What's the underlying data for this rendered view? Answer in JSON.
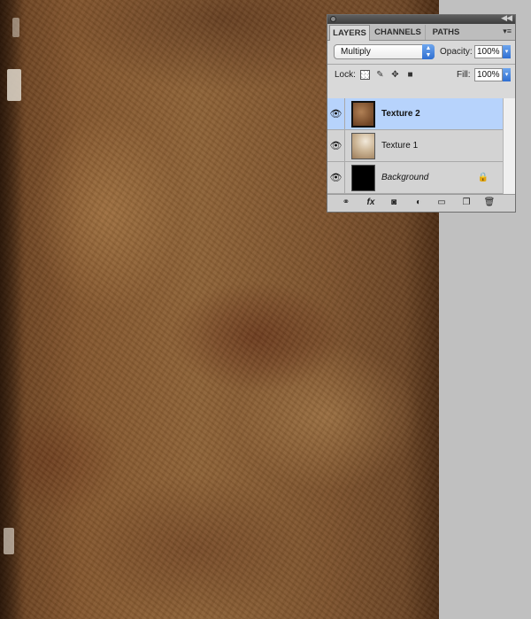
{
  "canvas": {
    "description_colors": {
      "accent": "#8e6236",
      "dark": "#3d230f"
    }
  },
  "panel": {
    "collapse_icon": "double-chevron-right",
    "tabs": [
      {
        "label": "LAYERS",
        "active": true
      },
      {
        "label": "CHANNELS",
        "active": false
      },
      {
        "label": "PATHS",
        "active": false
      }
    ],
    "blend_mode": "Multiply",
    "opacity_label": "Opacity:",
    "opacity_value": "100%",
    "lock_label": "Lock:",
    "fill_label": "Fill:",
    "fill_value": "100%",
    "layers": [
      {
        "name": "Texture 2",
        "selected": true,
        "visible": true
      },
      {
        "name": "Texture 1",
        "selected": false,
        "visible": true
      },
      {
        "name": "Background",
        "selected": false,
        "visible": true,
        "locked": true
      }
    ],
    "footer_icons": [
      "link-icon",
      "fx-icon",
      "mask-icon",
      "adjustment-icon",
      "group-folder-icon",
      "new-layer-icon",
      "trash-icon"
    ],
    "fx_label": "fx"
  },
  "colors": {
    "selection": "#b7d3fc",
    "panel_bg": "#d9d9d9",
    "workspace": "#c0c0c0"
  }
}
